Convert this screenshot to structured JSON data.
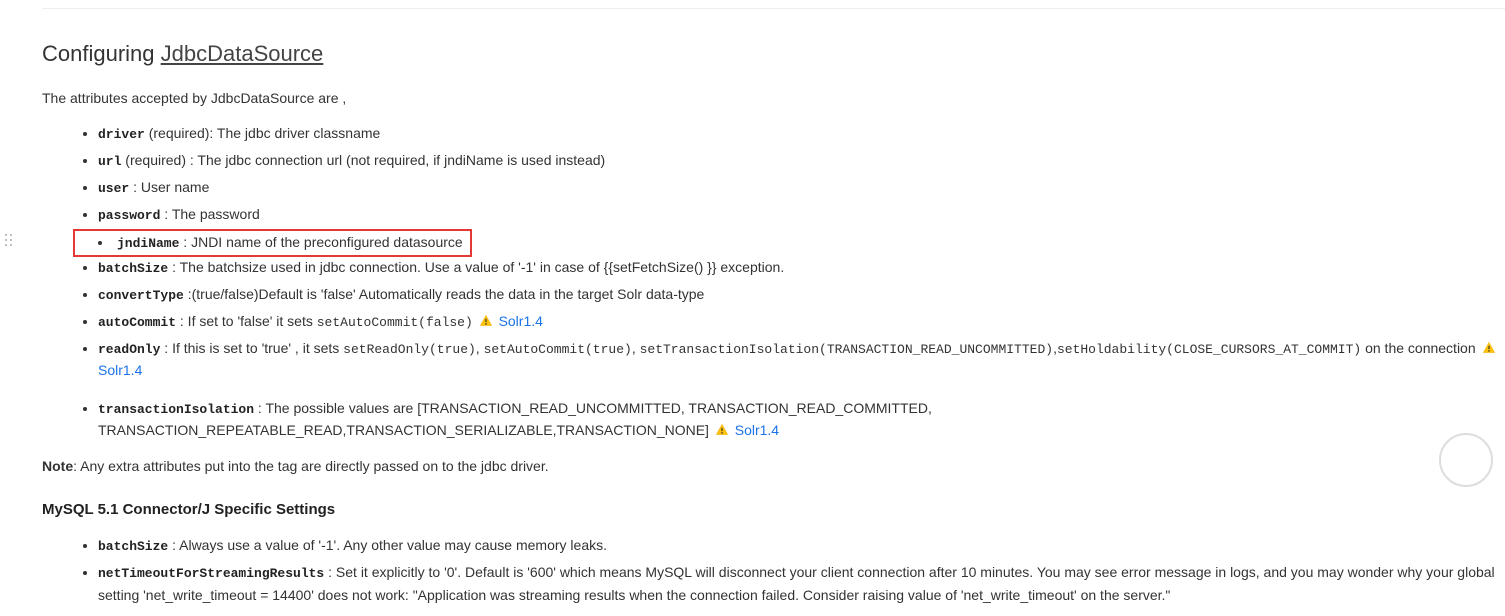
{
  "heading": {
    "prefix": "Configuring ",
    "link_text": "JdbcDataSource"
  },
  "intro": "The attributes accepted by JdbcDataSource are ,",
  "attrs": [
    {
      "name": "driver",
      "text": " (required): The jdbc driver classname"
    },
    {
      "name": "url",
      "text": " (required) : The jdbc connection url (not required, if jndiName is used instead)"
    },
    {
      "name": "user",
      "text": " : User name"
    },
    {
      "name": "password",
      "text": " : The password"
    },
    {
      "name": "jndiName",
      "text": " : JNDI name of the preconfigured datasource",
      "highlight": true
    },
    {
      "name": "batchSize",
      "text": " : The batchsize used in jdbc connection. Use a value of '-1' in case of {{setFetchSize() }} exception."
    },
    {
      "name": "convertType",
      "text": " :(true/false)Default is 'false' Automatically reads the data in the target Solr data-type"
    },
    {
      "name": "autoCommit",
      "text_before": " : If set to 'false' it sets ",
      "code": "setAutoCommit(false)",
      "warn": true,
      "link": "Solr1.4"
    },
    {
      "name": "readOnly",
      "text_before": " : If this is set to 'true' , it sets ",
      "code1": "setReadOnly(true)",
      "sep1": ", ",
      "code2": "setAutoCommit(true)",
      "sep2": ", ",
      "code3": "setTransactionIsolation(TRANSACTION_READ_UNCOMMITTED)",
      "sep3": ",",
      "code4": "setHoldability(CLOSE_CURSORS_AT_COMMIT)",
      "text_after": " on the connection ",
      "warn": true,
      "link": "Solr1.4"
    }
  ],
  "attrs2": [
    {
      "name": "transactionIsolation",
      "text": " : The possible values are [TRANSACTION_READ_UNCOMMITTED, TRANSACTION_READ_COMMITTED, TRANSACTION_REPEATABLE_READ,TRANSACTION_SERIALIZABLE,TRANSACTION_NONE] ",
      "warn": true,
      "link": "Solr1.4"
    }
  ],
  "note": {
    "label": "Note",
    "text": ": Any extra attributes put into the tag are directly passed on to the jdbc driver."
  },
  "h3": "MySQL 5.1 Connector/J Specific Settings",
  "mysql": [
    {
      "name": "batchSize",
      "text": " : Always use a value of '-1'. Any other value may cause memory leaks."
    },
    {
      "name": "netTimeoutForStreamingResults",
      "text": " : Set it explicitly to '0'. Default is '600' which means MySQL will disconnect your client connection after 10 minutes. You may see error message in logs, and you may wonder why your global setting 'net_write_timeout = 14400' does not work: \"Application was streaming results when the connection failed. Consider raising value of 'net_write_timeout' on the server.\""
    }
  ],
  "ghost_label": ""
}
